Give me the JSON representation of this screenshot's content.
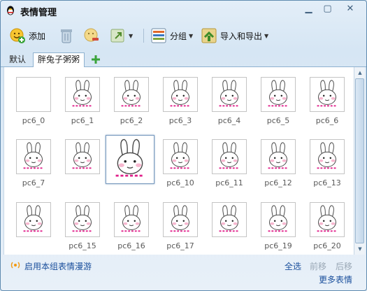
{
  "window": {
    "title": "表情管理"
  },
  "toolbar": {
    "add_label": "添加",
    "group_label": "分组",
    "import_export_label": "导入和导出"
  },
  "tabs": {
    "items": [
      {
        "label": "默认"
      },
      {
        "label": "胖兔子粥粥"
      }
    ]
  },
  "grid": {
    "items": [
      {
        "label": "pc6_0"
      },
      {
        "label": "pc6_1"
      },
      {
        "label": "pc6_2"
      },
      {
        "label": "pc6_3"
      },
      {
        "label": "pc6_4"
      },
      {
        "label": "pc6_5"
      },
      {
        "label": "pc6_6"
      },
      {
        "label": "pc6_7"
      },
      {
        "label": ""
      },
      {
        "label": ""
      },
      {
        "label": "pc6_10"
      },
      {
        "label": "pc6_11"
      },
      {
        "label": "pc6_12"
      },
      {
        "label": "pc6_13"
      },
      {
        "label": ""
      },
      {
        "label": "pc6_15"
      },
      {
        "label": "pc6_16"
      },
      {
        "label": "pc6_17"
      },
      {
        "label": ""
      },
      {
        "label": "pc6_19"
      },
      {
        "label": "pc6_20"
      }
    ]
  },
  "status": {
    "roaming_label": "启用本组表情漫游",
    "select_all": "全选",
    "move_forward": "前移",
    "move_back": "后移",
    "more_emoticons": "更多表情"
  },
  "colors": {
    "link": "#1a4f9c",
    "disabled": "#9aa8b6",
    "accent_pink": "#e0208a"
  }
}
